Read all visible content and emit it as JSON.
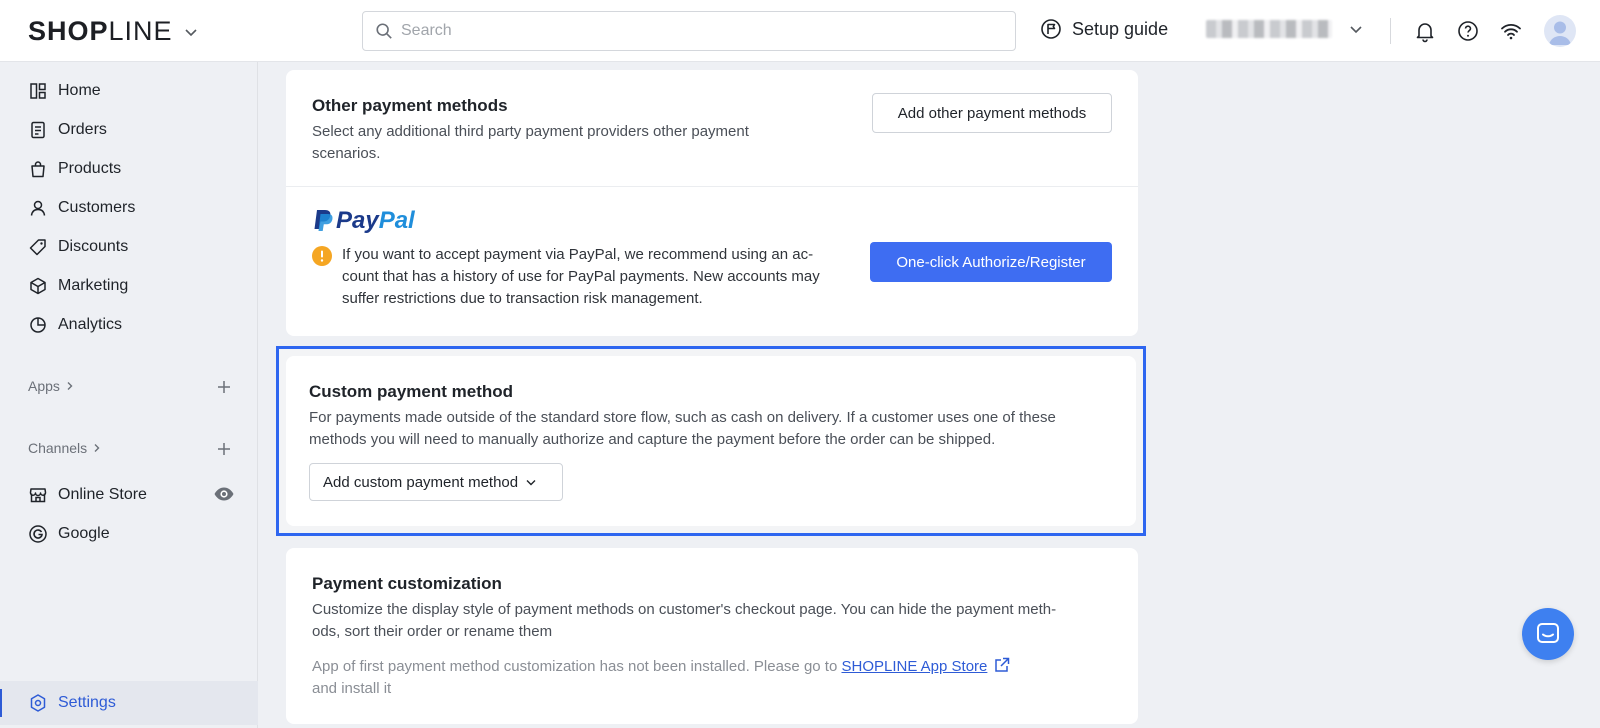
{
  "header": {
    "logo_left": "SHOP",
    "logo_right": "LINE",
    "search_placeholder": "Search",
    "setup_guide": "Setup guide"
  },
  "sidebar": {
    "items": [
      {
        "label": "Home",
        "icon": "home-icon"
      },
      {
        "label": "Orders",
        "icon": "orders-icon"
      },
      {
        "label": "Products",
        "icon": "products-icon"
      },
      {
        "label": "Customers",
        "icon": "customers-icon"
      },
      {
        "label": "Discounts",
        "icon": "discounts-icon"
      },
      {
        "label": "Marketing",
        "icon": "marketing-icon"
      },
      {
        "label": "Analytics",
        "icon": "analytics-icon"
      }
    ],
    "apps_label": "Apps",
    "channels_label": "Channels",
    "channels": [
      {
        "label": "Online Store",
        "icon": "store-icon"
      },
      {
        "label": "Google",
        "icon": "google-icon"
      }
    ],
    "settings_label": "Settings"
  },
  "other_methods": {
    "title": "Other payment methods",
    "description_line1": "Select any additional third party payment providers other payment",
    "description_line2": "scenarios.",
    "add_button": "Add other payment methods",
    "paypal_brand_1": "Pay",
    "paypal_brand_2": "Pal",
    "paypal_notice_line1": "If you want to accept payment via PayPal, we recommend using an ac-",
    "paypal_notice_line2": "count that has a history of use for PayPal payments. New accounts may",
    "paypal_notice_line3": "suffer restrictions due to transaction risk management.",
    "authorize_button": "One-click Authorize/Register"
  },
  "custom_method": {
    "title": "Custom payment method",
    "description_line1": "For payments made outside of the standard store flow, such as cash on delivery. If a customer uses one of these",
    "description_line2": "methods you will need to manually authorize and capture the payment before the order can be shipped.",
    "add_button": "Add custom payment method"
  },
  "customization": {
    "title": "Payment customization",
    "description_line1": "Customize the display style of payment methods on customer's checkout page. You can hide the payment meth-",
    "description_line2": "ods, sort their order or rename them",
    "notice_prefix": "App of first payment method customization has not been installed. Please go to ",
    "notice_link": "SHOPLINE App Store",
    "notice_suffix": "and install it"
  },
  "colors": {
    "primary": "#3e6df2",
    "highlight_border": "#2e66f0",
    "warning": "#f5a623",
    "link": "#2e5bd6"
  }
}
